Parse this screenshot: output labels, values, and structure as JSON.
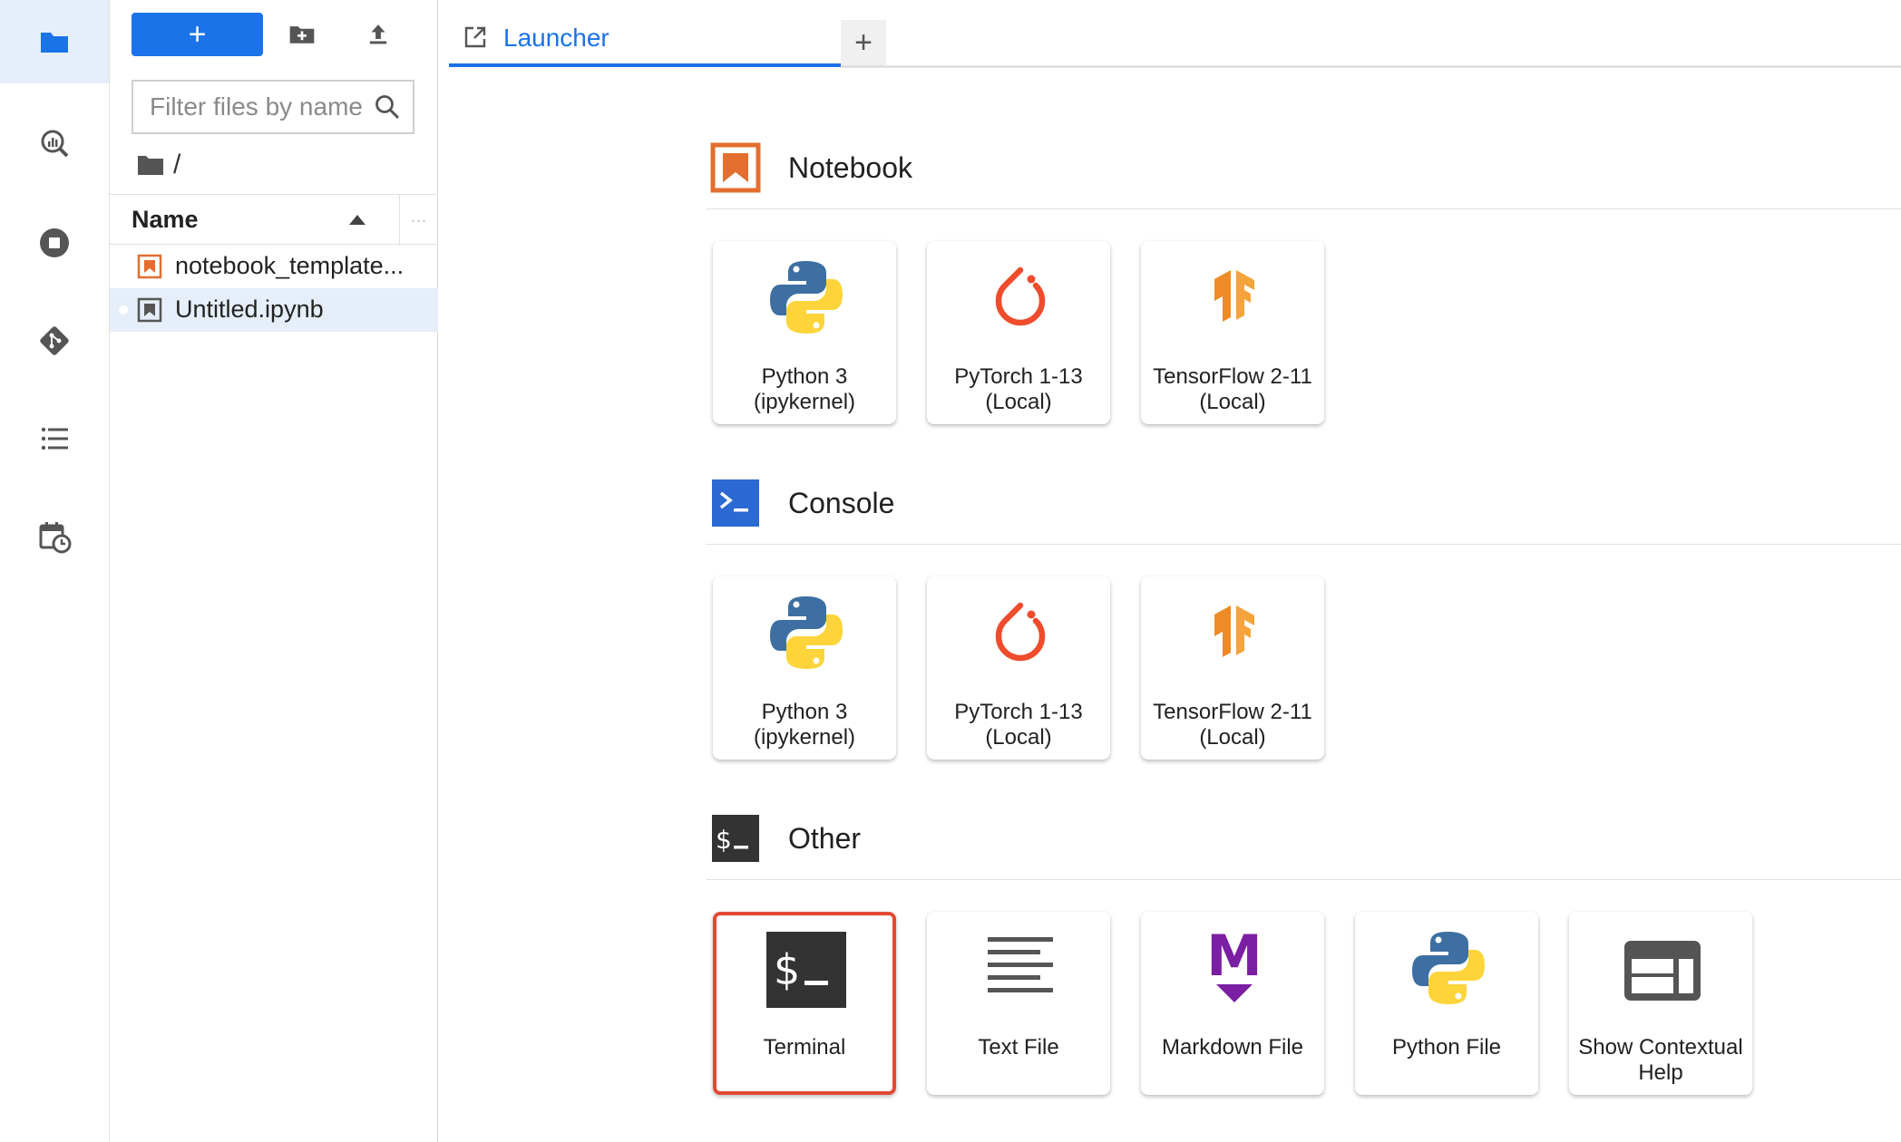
{
  "activity_bar": {
    "items": [
      {
        "name": "file-browser",
        "icon": "folder-icon",
        "active": true
      },
      {
        "name": "property-inspector",
        "icon": "inspector-icon",
        "active": false
      },
      {
        "name": "running-kernels",
        "icon": "stop-circle-icon",
        "active": false
      },
      {
        "name": "git",
        "icon": "git-icon",
        "active": false
      },
      {
        "name": "table-of-contents",
        "icon": "list-icon",
        "active": false
      },
      {
        "name": "scheduler",
        "icon": "calendar-clock-icon",
        "active": false
      }
    ]
  },
  "file_browser": {
    "new_button_label": "+",
    "filter_placeholder": "Filter files by name",
    "breadcrumb": "/",
    "column_header": "Name",
    "column_more": "...",
    "files": [
      {
        "name": "notebook_template...",
        "icon": "notebook-orange-icon",
        "selected": false
      },
      {
        "name": "Untitled.ipynb",
        "icon": "notebook-gray-icon",
        "selected": true
      }
    ]
  },
  "tabs": [
    {
      "label": "Launcher",
      "icon": "launcher-icon",
      "active": true
    }
  ],
  "add_tab_label": "+",
  "launcher": {
    "sections": [
      {
        "title": "Notebook",
        "icon": "notebook-icon",
        "cards": [
          {
            "label": "Python 3 (ipykernel)",
            "icon": "python-icon"
          },
          {
            "label": "PyTorch 1-13 (Local)",
            "icon": "pytorch-icon"
          },
          {
            "label": "TensorFlow 2-11 (Local)",
            "icon": "tensorflow-icon"
          }
        ]
      },
      {
        "title": "Console",
        "icon": "console-icon",
        "cards": [
          {
            "label": "Python 3 (ipykernel)",
            "icon": "python-icon"
          },
          {
            "label": "PyTorch 1-13 (Local)",
            "icon": "pytorch-icon"
          },
          {
            "label": "TensorFlow 2-11 (Local)",
            "icon": "tensorflow-icon"
          }
        ]
      },
      {
        "title": "Other",
        "icon": "terminal-icon",
        "cards": [
          {
            "label": "Terminal",
            "icon": "terminal-icon",
            "highlighted": true
          },
          {
            "label": "Text File",
            "icon": "text-file-icon"
          },
          {
            "label": "Markdown File",
            "icon": "markdown-icon"
          },
          {
            "label": "Python File",
            "icon": "python-icon"
          },
          {
            "label": "Show Contextual Help",
            "icon": "contextual-help-icon"
          }
        ]
      }
    ]
  },
  "colors": {
    "accent": "#1a73e8",
    "highlight_border": "#e24a35",
    "notebook_orange": "#e46e2e",
    "pytorch_red": "#ee4c2c",
    "tensorflow_orange": "#f08a24",
    "markdown_purple": "#7b1fa2"
  }
}
